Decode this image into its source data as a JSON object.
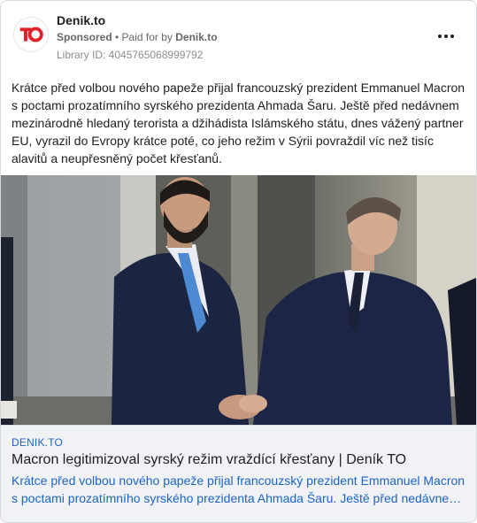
{
  "post": {
    "page_name": "Denik.to",
    "sponsored_label": "Sponsored",
    "separator": " • ",
    "paid_for_prefix": "Paid for by ",
    "paid_for_name": "Denik.to",
    "library_id": "Library ID: 4045765068999792",
    "avatar_icon": "denik-to-logo",
    "avatar_text": "TO",
    "more_icon": "more-options-icon",
    "body": "Krátce před volbou nového papeže přijal francouzský prezident Emmanuel Macron s poctami prozatímního syrského prezidenta Ahmada Šaru. Ještě před nedávnem mezinárodně hledaný terorista a džihádista Islámského státu, dnes vážený partner EU, vyrazil do Evropy krátce poté, co jeho režim v Sýrii povraždil víc než tisíc alavitů a neupřesněný počet křesťanů."
  },
  "link": {
    "domain": "DENIK.TO",
    "title": "Macron legitimizoval syrský režim vraždící křesťany | Deník TO",
    "description": "Krátce před volbou nového papeže přijal francouzský prezident Emmanuel Macron s poctami prozatímního syrského prezidenta Ahmada Šaru. Ještě před nedávnem mezinárodně hledaný terorista..."
  },
  "colors": {
    "link_blue": "#1d64c4",
    "logo_red": "#e0222b"
  }
}
